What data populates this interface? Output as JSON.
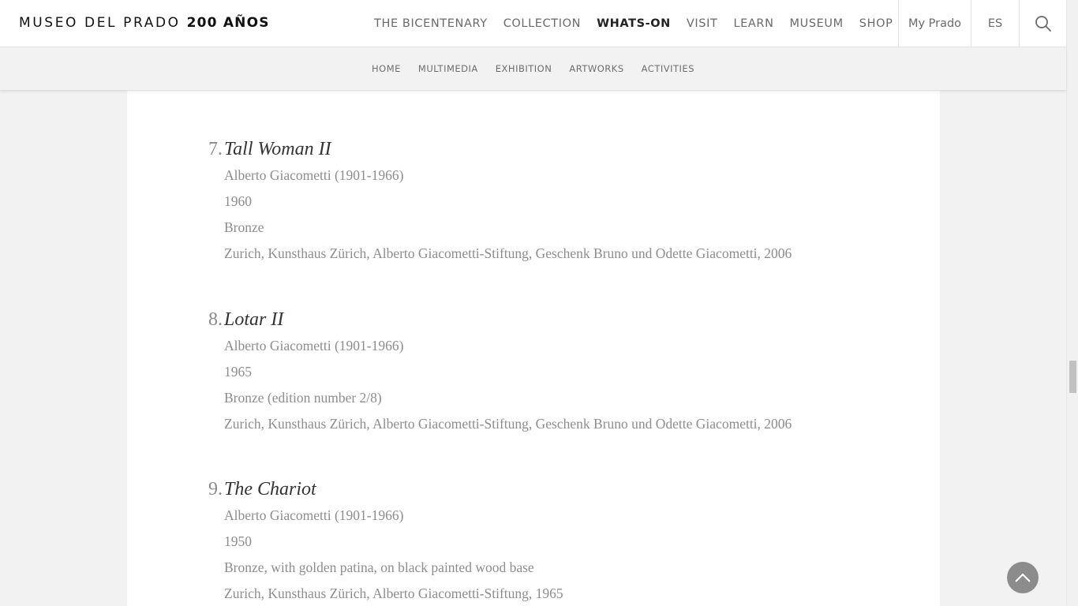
{
  "brand": {
    "name": "MUSEO DEL PRADO",
    "anniversary": "200 AÑOS"
  },
  "main_nav": [
    {
      "label": "THE BICENTENARY",
      "active": false
    },
    {
      "label": "COLLECTION",
      "active": false
    },
    {
      "label": "WHATS-ON",
      "active": true
    },
    {
      "label": "VISIT",
      "active": false
    },
    {
      "label": "LEARN",
      "active": false
    },
    {
      "label": "MUSEUM",
      "active": false
    },
    {
      "label": "SHOP",
      "active": false
    }
  ],
  "account": {
    "label": "My Prado"
  },
  "language": {
    "label": "ES"
  },
  "sub_nav": [
    "HOME",
    "MULTIMEDIA",
    "EXHIBITION",
    "ARTWORKS",
    "ACTIVITIES"
  ],
  "entries": [
    {
      "number": "7.",
      "title": "Tall Woman II",
      "artist": "Alberto Giacometti (1901-1966)",
      "date": "1960",
      "medium": "Bronze",
      "collection": "Zurich, Kunsthaus Zürich, Alberto Giacometti-Stiftung, Geschenk Bruno und Odette Giacometti, 2006"
    },
    {
      "number": "8.",
      "title": "Lotar II",
      "artist": "Alberto Giacometti (1901-1966)",
      "date": "1965",
      "medium": "Bronze (edition number 2/8)",
      "collection": "Zurich, Kunsthaus Zürich, Alberto Giacometti-Stiftung, Geschenk Bruno und Odette Giacometti, 2006"
    },
    {
      "number": "9.",
      "title": "The Chariot",
      "artist": "Alberto Giacometti (1901-1966)",
      "date": "1950",
      "medium": "Bronze, with golden patina, on black painted wood base",
      "collection": "Zurich, Kunsthaus Zürich, Alberto Giacometti-Stiftung, 1965"
    }
  ],
  "colors": {
    "accent_text": "#333333",
    "muted_text": "#8d8d8d",
    "page_bg": "#f2f2f2",
    "card_bg": "#ffffff"
  },
  "icons": {
    "search": "search-icon",
    "back_to_top": "chevron-up-icon"
  }
}
